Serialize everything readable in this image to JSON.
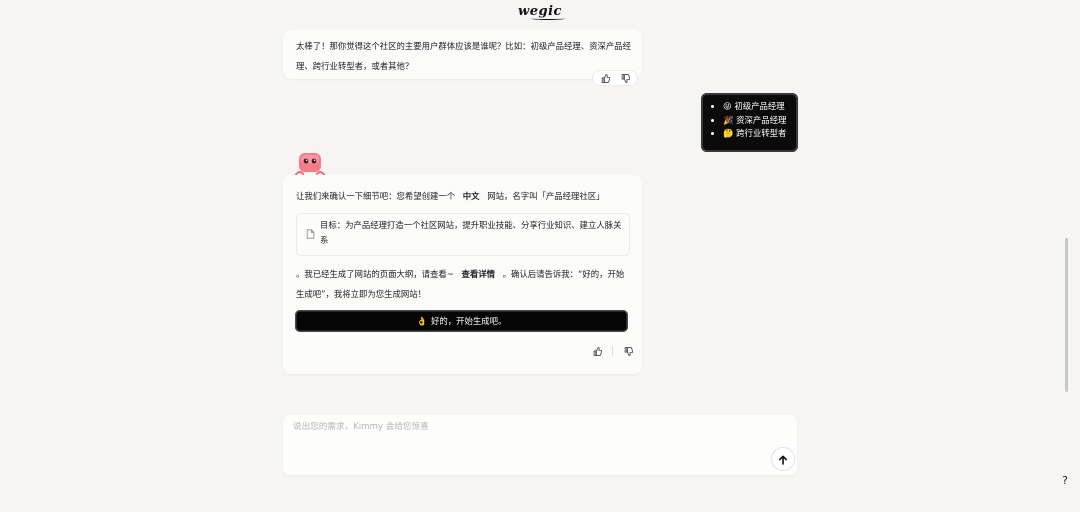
{
  "header": {
    "logo_text": "wegic"
  },
  "messages": {
    "prev_ai": {
      "text": "太棒了！那你觉得这个社区的主要用户群体应该是谁呢？比如：初级产品经理、资深产品经理、跨行业转型者，或者其他？"
    },
    "user": {
      "items": [
        "😝 初级产品经理",
        "🎉 资深产品经理",
        "🤔 跨行业转型者"
      ]
    },
    "ai": {
      "line1_pre": "让我们来确认一下细节吧：您希望创建一个",
      "line1_lang": "中文",
      "line1_post": "网站，名字叫「产品经理社区」",
      "goal": "目标：为产品经理打造一个社区网站，提升职业技能、分享行业知识、建立人脉关系",
      "para_pre": "。我已经生成了网站的页面大纲，请查看~",
      "para_link": "查看详情",
      "para_post": "。确认后请告诉我：“好的，开始生成吧”，我将立即为您生成网站！",
      "button_emoji": "👌",
      "button_label": "好的，开始生成吧。"
    }
  },
  "input": {
    "placeholder": "说出您的需求，Kimmy 会给您惊喜"
  },
  "help": {
    "label": "?"
  },
  "colors": {
    "background": "#f6f5f4",
    "dark_button": "#050505",
    "card": "#fbfbfa"
  }
}
